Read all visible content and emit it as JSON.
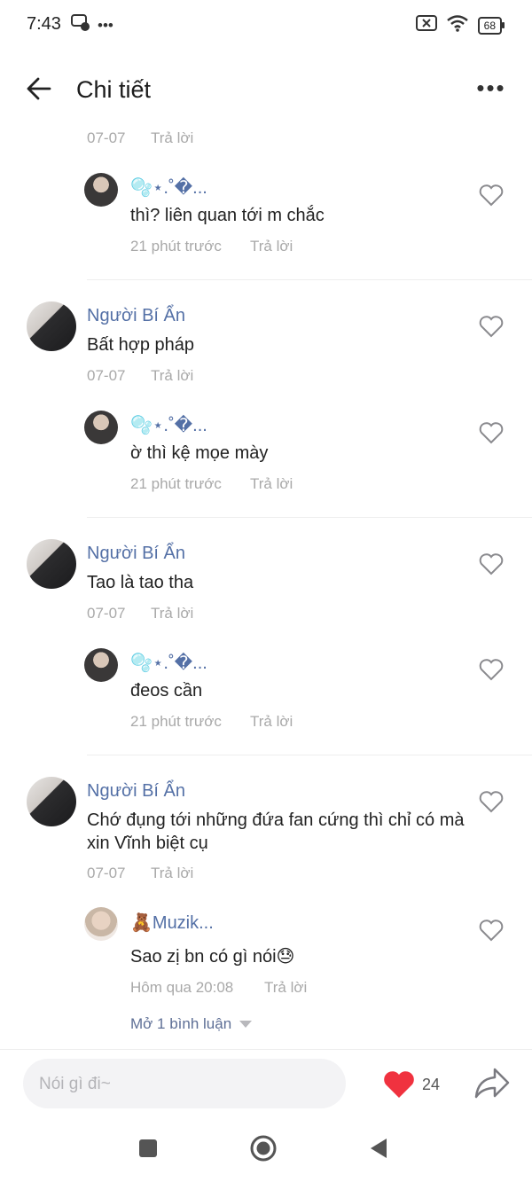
{
  "status_bar": {
    "time": "7:43",
    "battery": "68"
  },
  "header": {
    "title": "Chi tiết"
  },
  "comments": [
    {
      "top_meta": {
        "date": "07-07",
        "reply": "Trả lời"
      },
      "reply_item": {
        "username": "🫧⋆.˚�...",
        "text": "thì? liên quan tới m chắc",
        "time": "21 phút trước",
        "reply": "Trả lời"
      }
    },
    {
      "username": "Người Bí Ẩn",
      "text": "Bất hợp pháp",
      "date": "07-07",
      "reply": "Trả lời",
      "reply_item": {
        "username": "🫧⋆.˚�...",
        "text": "ờ thì kệ mọe mày",
        "time": "21 phút trước",
        "reply": "Trả lời"
      }
    },
    {
      "username": "Người Bí Ẩn",
      "text": "Tao là tao tha",
      "date": "07-07",
      "reply": "Trả lời",
      "reply_item": {
        "username": "🫧⋆.˚�...",
        "text": "đeos cần",
        "time": "21 phút trước",
        "reply": "Trả lời"
      }
    },
    {
      "username": "Người Bí Ẩn",
      "text": "Chớ đụng tới những đứa fan cứng thì chỉ có mà xin Vĩnh biệt cụ",
      "date": "07-07",
      "reply": "Trả lời",
      "reply_item": {
        "username": "🧸Muzik...",
        "text": "Sao zị bn có gì nói😓",
        "time": "Hôm qua 20:08",
        "reply": "Trả lời"
      },
      "expand_label": "Mở 1 bình luận"
    }
  ],
  "bottom_bar": {
    "placeholder": "Nói gì đi~",
    "like_count": "24"
  },
  "colors": {
    "heart_active": "#f0323f",
    "username": "#5470a6",
    "meta": "#a9a9a9"
  },
  "icons": [
    "back-arrow-icon",
    "more-dots-icon",
    "heart-outline-icon",
    "heart-filled-icon",
    "share-icon",
    "nav-square-icon",
    "nav-circle-icon",
    "nav-triangle-icon"
  ]
}
